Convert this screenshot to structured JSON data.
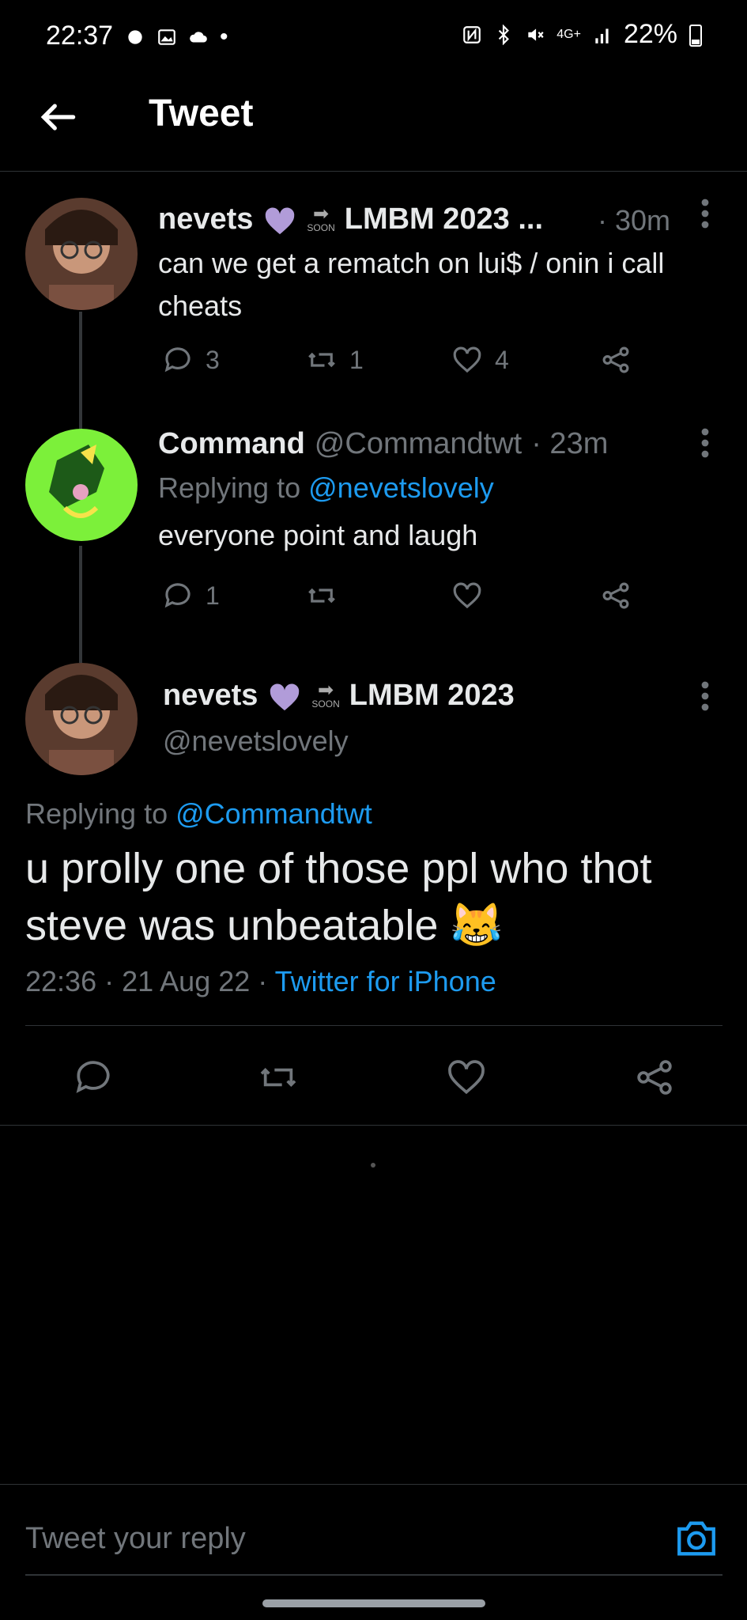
{
  "status_bar": {
    "time": "22:37",
    "battery": "22%",
    "network": "4G+"
  },
  "header": {
    "title": "Tweet"
  },
  "thread": [
    {
      "display_name": "nevets",
      "name_suffix": "LMBM 2023 ...",
      "soon": "SOON",
      "time": "· 30m",
      "text": "can we get a rematch on lui$ / onin i call cheats",
      "replies": "3",
      "retweets": "1",
      "likes": "4"
    },
    {
      "display_name": "Command",
      "handle": "@Commandtwt",
      "time": "· 23m",
      "replying_label": "Replying to",
      "replying_to": "@nevetslovely",
      "text": "everyone point and laugh",
      "replies": "1",
      "retweets": "",
      "likes": ""
    }
  ],
  "main_tweet": {
    "display_name": "nevets",
    "name_suffix": "LMBM 2023",
    "soon": "SOON",
    "handle": "@nevetslovely",
    "replying_label": "Replying to",
    "replying_to": "@Commandtwt",
    "text": "u prolly one of those ppl who thot steve was unbeatable 😹",
    "time": "22:36",
    "date": "· 21 Aug 22 ·",
    "source": "Twitter for iPhone"
  },
  "reply_box": {
    "placeholder": "Tweet your reply"
  },
  "colors": {
    "accent": "#1d9bf0",
    "heart_emoji": "#b19cd9"
  }
}
